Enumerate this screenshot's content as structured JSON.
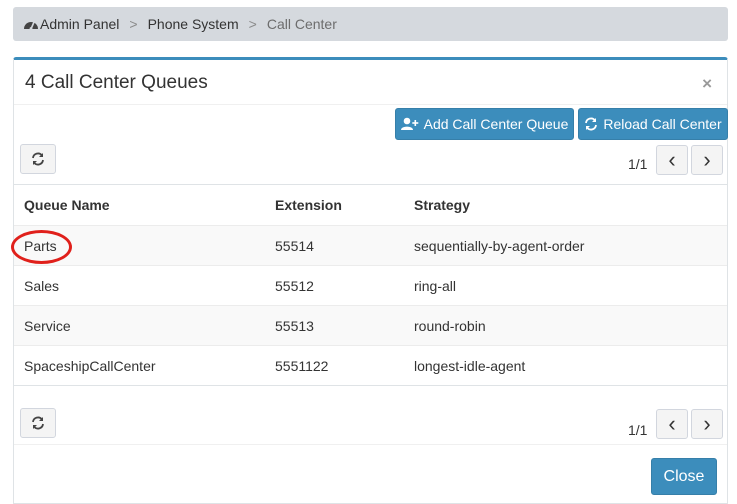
{
  "breadcrumb": {
    "items": [
      "Admin Panel",
      "Phone System",
      "Call Center"
    ],
    "separator": ">"
  },
  "panel": {
    "title": "4 Call Center Queues",
    "close_symbol": "×",
    "accent_color": "#3c8dbc"
  },
  "toolbar": {
    "add_label": "Add Call Center Queue",
    "reload_label": "Reload Call Center"
  },
  "pagination": {
    "top_text": "1/1",
    "bottom_text": "1/1",
    "prev_symbol": "‹",
    "next_symbol": "›"
  },
  "table": {
    "columns": [
      "Queue Name",
      "Extension",
      "Strategy"
    ],
    "rows": [
      {
        "name": "Parts",
        "extension": "55514",
        "strategy": "sequentially-by-agent-order"
      },
      {
        "name": "Sales",
        "extension": "55512",
        "strategy": "ring-all"
      },
      {
        "name": "Service",
        "extension": "55513",
        "strategy": "round-robin"
      },
      {
        "name": "SpaceshipCallCenter",
        "extension": "5551122",
        "strategy": "longest-idle-agent"
      }
    ]
  },
  "footer": {
    "close_label": "Close"
  },
  "icons": {
    "breadcrumb": "dashboard-gauge-icon",
    "add": "user-plus-icon",
    "reload": "refresh-icon",
    "refresh": "refresh-icon"
  },
  "annotation": {
    "highlight_color": "#e0201b",
    "highlighted_row": "Parts"
  }
}
